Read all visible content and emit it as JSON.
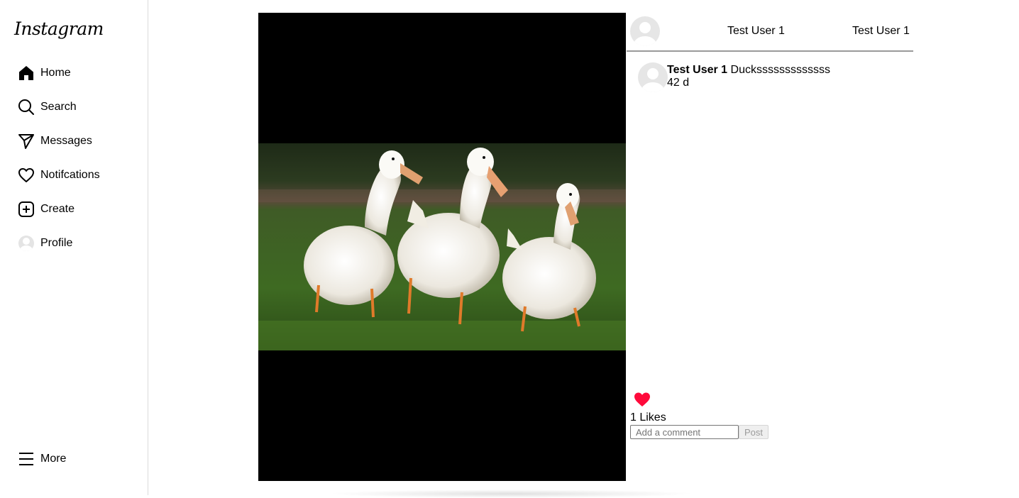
{
  "sidebar": {
    "logo": "Instagram",
    "items": [
      {
        "label": "Home",
        "icon": "home-icon"
      },
      {
        "label": "Search",
        "icon": "search-icon"
      },
      {
        "label": "Messages",
        "icon": "send-icon"
      },
      {
        "label": "Notifcations",
        "icon": "heart-icon"
      },
      {
        "label": "Create",
        "icon": "plus-square-icon"
      },
      {
        "label": "Profile",
        "icon": "avatar-icon"
      }
    ],
    "more": {
      "label": "More",
      "icon": "menu-icon"
    }
  },
  "post": {
    "image": "ducks-photo",
    "header": {
      "username": "Test User 1",
      "username_right": "Test User 1"
    },
    "caption": {
      "username": "Test User 1",
      "text": "Ducksssssssssssss",
      "time": "42 d"
    },
    "likes": "1 Likes",
    "liked": true,
    "comment": {
      "placeholder": "Add a comment",
      "post_label": "Post"
    }
  },
  "colors": {
    "like": "#ff0a3b",
    "border": "#dbdbdb",
    "header_rule": "#9a9a9a"
  }
}
